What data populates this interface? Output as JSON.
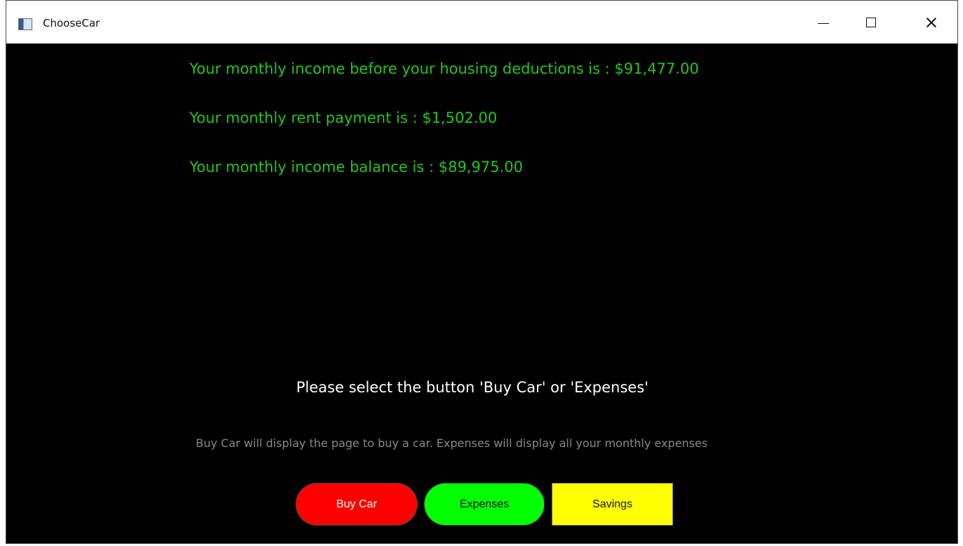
{
  "window": {
    "title": "ChooseCar",
    "app_icon": "window-app-icon",
    "controls": {
      "minimize_icon": "minimize-icon",
      "maximize_icon": "maximize-icon",
      "close_icon": "close-icon"
    }
  },
  "summary": {
    "income_before_housing": "Your monthly income before your housing deductions is : $91,477.00",
    "rent_payment": "Your monthly rent payment is : $1,502.00",
    "income_balance": "Your monthly income balance is : $89,975.00"
  },
  "instructions": {
    "main": "Please select the button 'Buy Car' or 'Expenses'",
    "description": "Buy Car will display the page to buy a car. Expenses will display all your monthly expenses"
  },
  "buttons": {
    "buy_car": "Buy Car",
    "expenses": "Expenses",
    "savings": "Savings"
  },
  "colors": {
    "summary_text": "#25c51b",
    "background": "#000000",
    "buy_car_button": "#ff0000",
    "expenses_button": "#00ff00",
    "savings_button": "#ffff00"
  }
}
